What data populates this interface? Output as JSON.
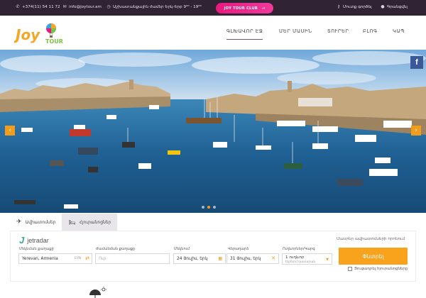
{
  "topbar": {
    "phone": "+374(11) 54 11 72",
    "email": "info@joytour.am",
    "hours": "Աշխատանքային ժամեր Երկ-Երբ 9⁰⁰ - 19⁰⁰",
    "club_button": "JOY TOUR CLUB",
    "register": "Մուտք գործել",
    "login": "Գրանցվել"
  },
  "logo": {
    "word1": "Joy",
    "word2": "TOUR"
  },
  "nav": {
    "items": [
      "ԳԼԽԱՎՈՐ ԷՋ",
      "ՄԵՐ ՄԱՍԻՆ",
      "ՏՈՒՐԵՐ",
      "ԲԼՈԳ",
      "ԿԱՊ"
    ],
    "active": 0
  },
  "hero": {
    "prev_label": "‹",
    "next_label": "›",
    "facebook": "f",
    "slides": 3,
    "active_slide": 1
  },
  "search": {
    "tabs": [
      "Ավիատոմսեր",
      "Հյուրանոցներ"
    ],
    "active_tab": 0,
    "provider": "jetradar",
    "link": "Մասրեր ավիատոմսերի որոնում",
    "fields": {
      "from_label": "Մեկնման քաղաքը",
      "from_value": "Yerevan, Armenia",
      "from_code": "EVN",
      "to_label": "Ժամանման քաղաքը",
      "to_placeholder": "Ուր",
      "depart_label": "Մեկնում",
      "depart_value": "24 Յուլիս, երկ",
      "return_label": "Վերադարձ",
      "return_value": "31 Յուլիս, երկ",
      "pass_label": "Ուղևորներ/Կարգ",
      "pass_value": "1 ուղևոր",
      "pass_class": "Էկոնոմ դասարան"
    },
    "submit": "Փնտրել",
    "hotel_check": "Ցուցադրել հյուրանոցները"
  },
  "colors": {
    "topbar": "#2f2334",
    "accent": "#f9a21c",
    "club": "#e8197d"
  }
}
